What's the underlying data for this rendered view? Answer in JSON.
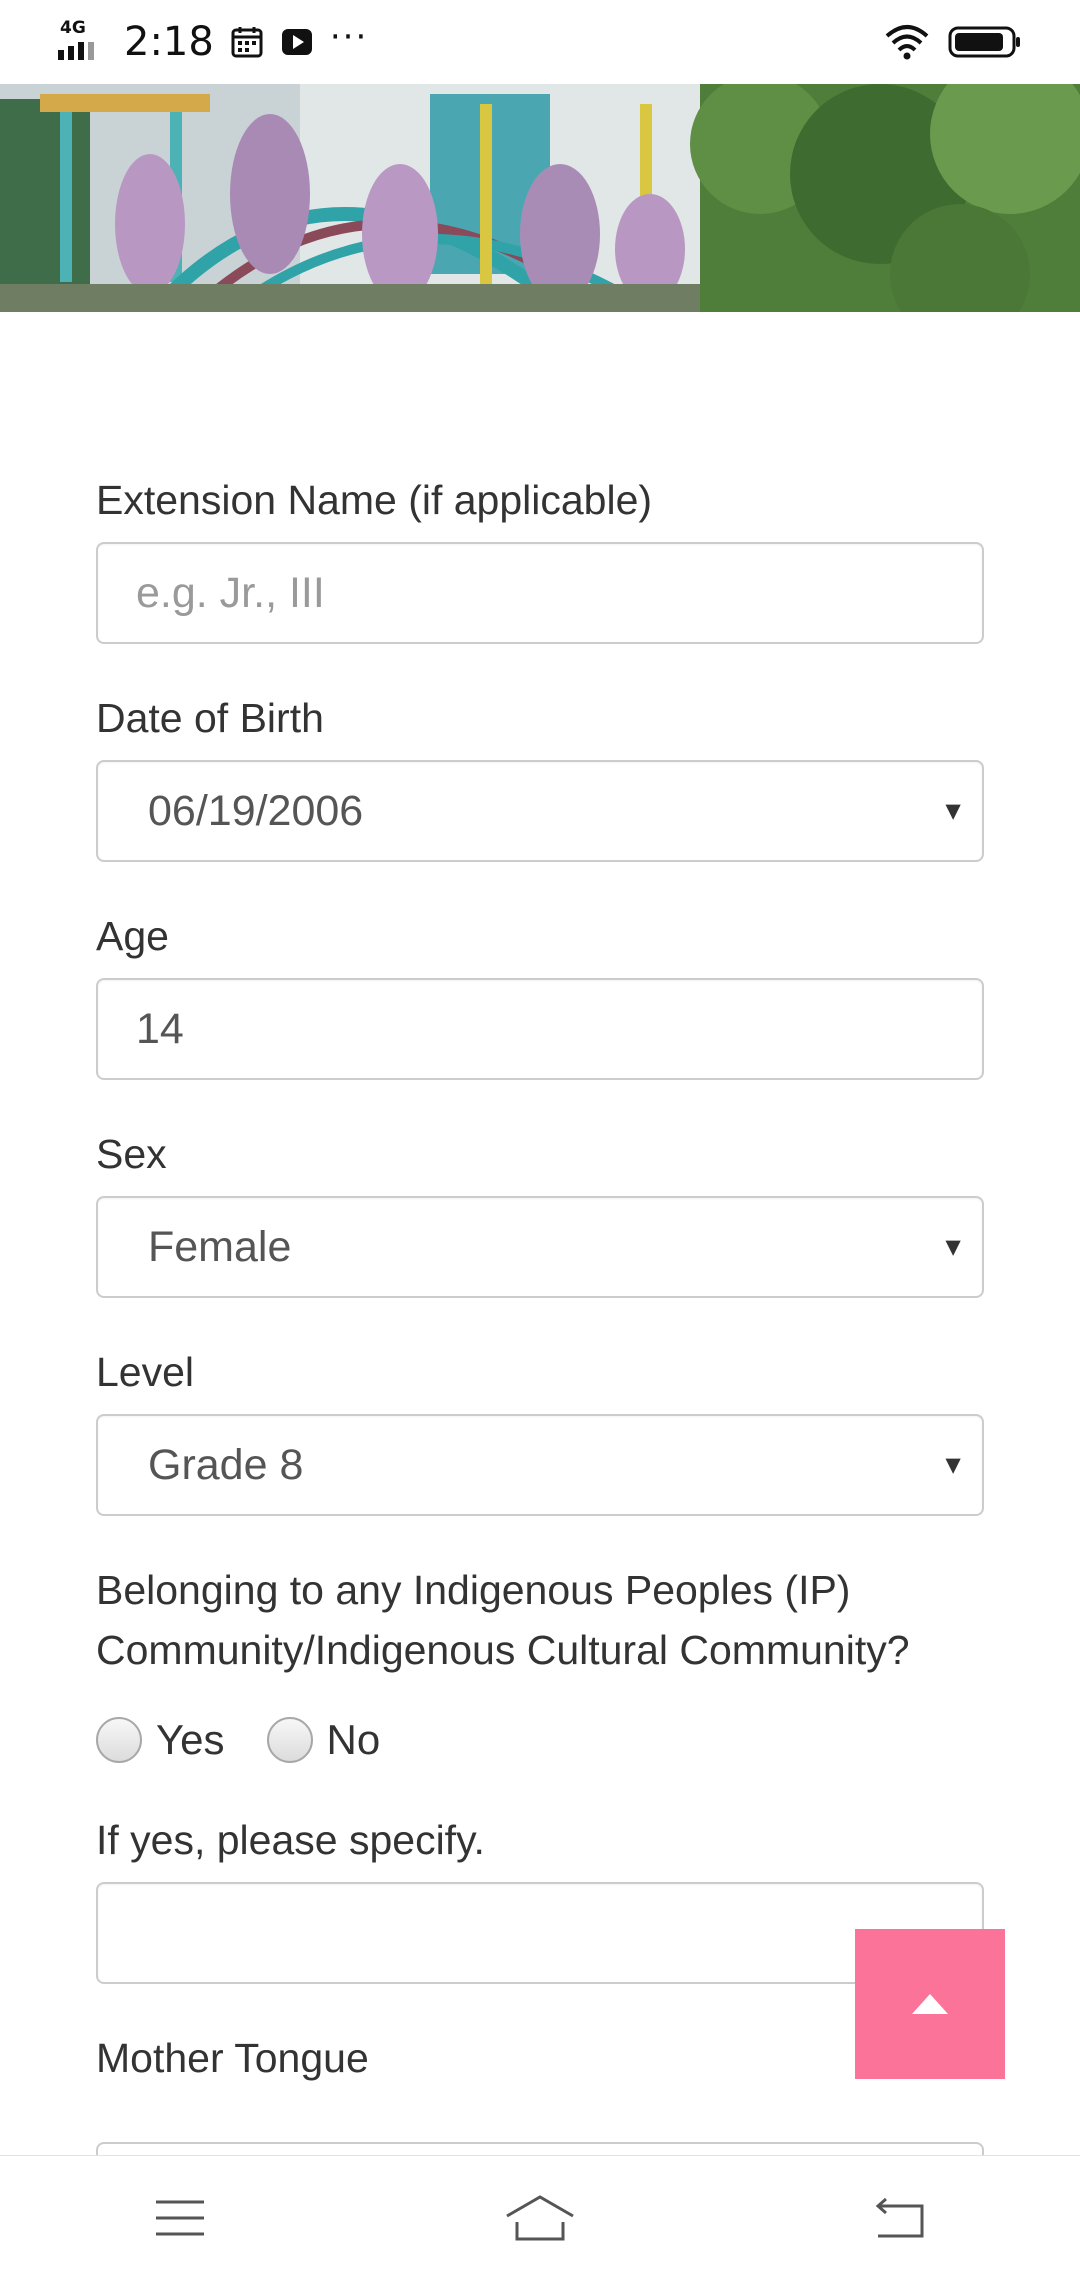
{
  "status_bar": {
    "network": "4G",
    "time": "2:18",
    "icons": [
      "signal-icon",
      "calendar-icon",
      "play-icon",
      "more-dots-icon",
      "wifi-icon",
      "battery-icon"
    ]
  },
  "form": {
    "extension_name": {
      "label": "Extension Name (if applicable)",
      "placeholder": "e.g. Jr., III",
      "value": ""
    },
    "date_of_birth": {
      "label": "Date of Birth",
      "value": "06/19/2006"
    },
    "age": {
      "label": "Age",
      "value": "14"
    },
    "sex": {
      "label": "Sex",
      "value": "Female"
    },
    "level": {
      "label": "Level",
      "value": "Grade 8"
    },
    "ip_community": {
      "question": "Belonging to any Indigenous Peoples (IP) Community/Indigenous Cultural Community?",
      "options": [
        "Yes",
        "No"
      ]
    },
    "ip_specify": {
      "label": "If yes, please specify.",
      "value": ""
    },
    "mother_tongue": {
      "label": "Mother Tongue"
    }
  },
  "colors": {
    "accent": "#fc7399",
    "border": "#cccccc",
    "text": "#333333"
  },
  "nav": {
    "icons": [
      "menu-icon",
      "home-icon",
      "back-icon"
    ]
  }
}
